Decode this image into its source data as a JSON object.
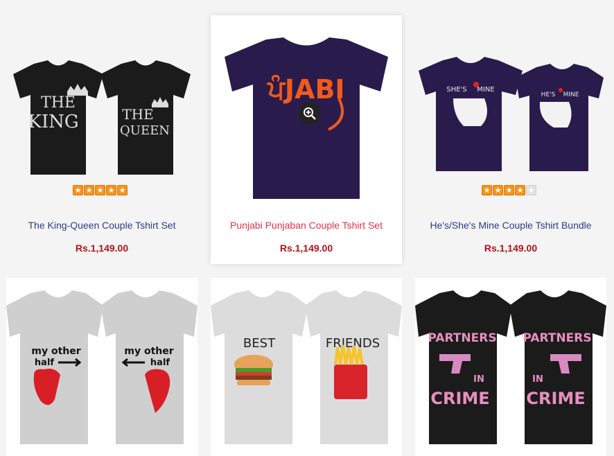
{
  "products": [
    {
      "name": "The King-Queen Couple Tshirt Set",
      "price": "Rs.1,149.00",
      "rating": 5,
      "shirt_color": "#1b1b1b",
      "print_left": [
        "THE",
        "KING"
      ],
      "print_right": [
        "THE",
        "QUEEN"
      ]
    },
    {
      "name": "Punjabi Punjaban Couple Tshirt Set",
      "price": "Rs.1,149.00",
      "rating": 0,
      "shirt_color": "#2a1b4d",
      "print_left": [
        "ਪੰJABI"
      ],
      "print_right": []
    },
    {
      "name": "He's/She's Mine Couple Tshirt Bundle",
      "price": "Rs.1,149.00",
      "rating": 4,
      "shirt_color": "#2a1b4d",
      "print_left": [
        "SHE'S",
        "MINE"
      ],
      "print_right": [
        "HE'S",
        "MINE"
      ]
    },
    {
      "name": "",
      "price": "",
      "rating": 0,
      "shirt_color": "#cfcfcf",
      "print_left": [
        "my other",
        "half"
      ],
      "print_right": [
        "my other",
        "half"
      ]
    },
    {
      "name": "",
      "price": "",
      "rating": 0,
      "shirt_color": "#dcdcdc",
      "print_left": [
        "BEST"
      ],
      "print_right": [
        "FRIENDS"
      ]
    },
    {
      "name": "",
      "price": "",
      "rating": 0,
      "shirt_color": "#1b1b1b",
      "print_left": [
        "PARTNERS",
        "IN",
        "CRIME"
      ],
      "print_right": [
        "PARTNERS",
        "IN",
        "CRIME"
      ]
    }
  ],
  "icons": {
    "zoom": "magnifier-plus-icon",
    "star": "star-icon"
  },
  "colors": {
    "link": "#2e3a8c",
    "link_hover": "#e0334a",
    "price": "#b3121b",
    "star": "#f7941d"
  }
}
